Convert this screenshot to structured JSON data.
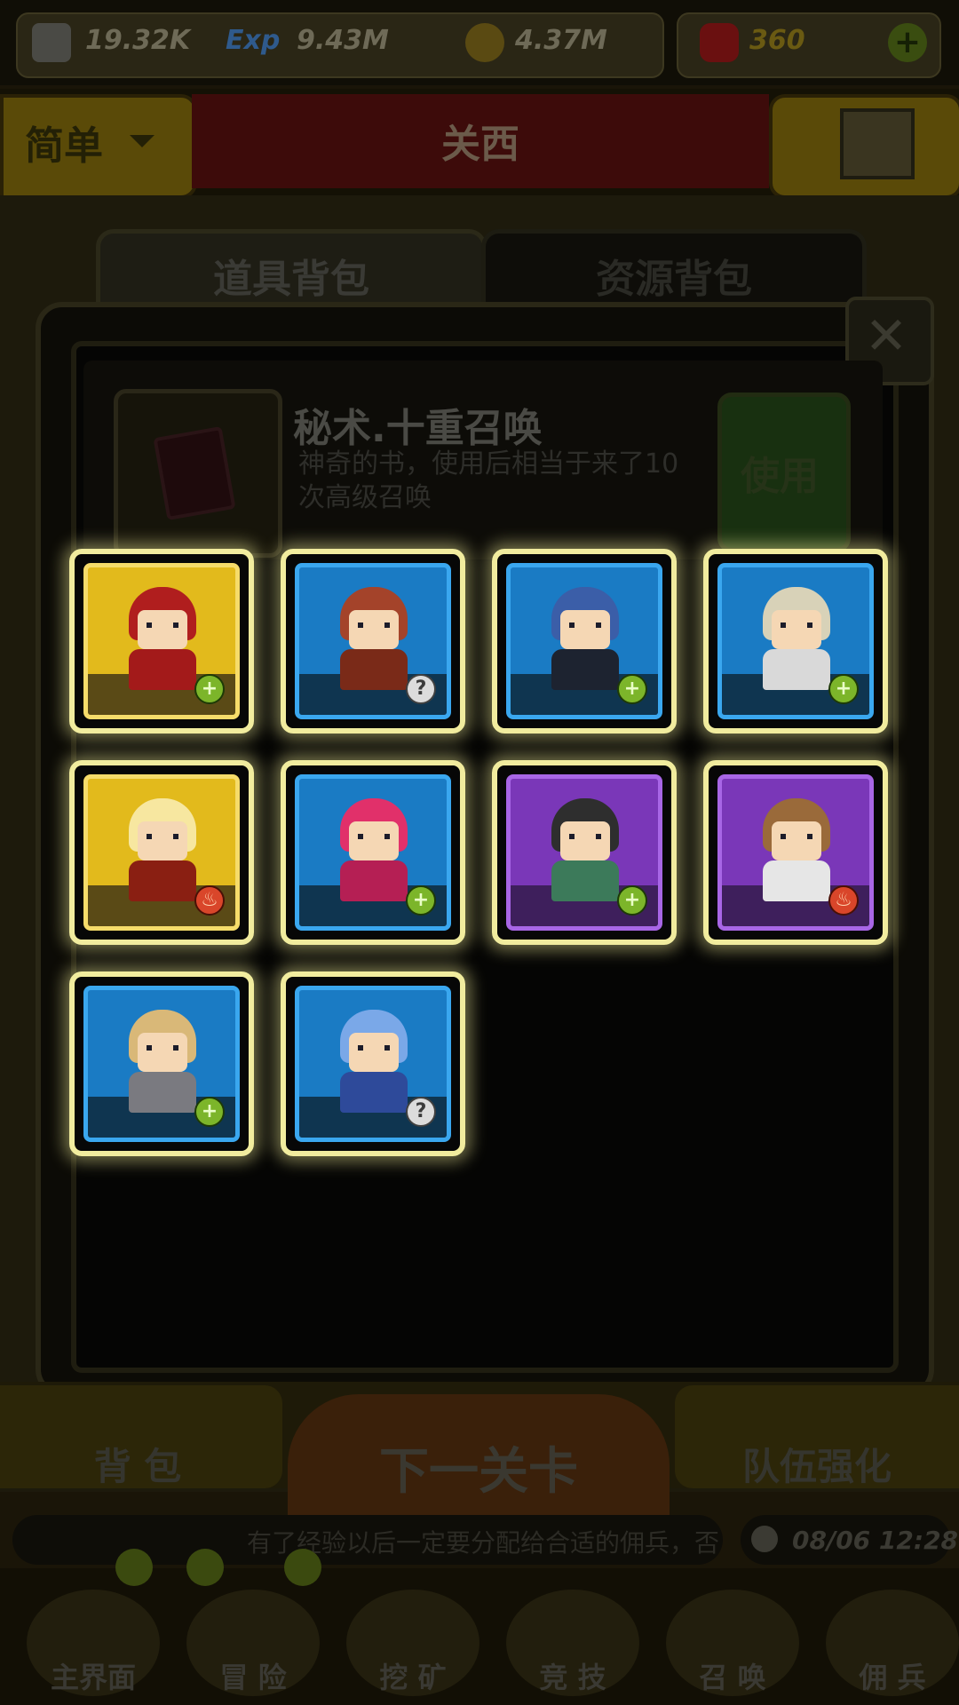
{
  "resources": {
    "attack": "19.32K",
    "exp": "9.43M",
    "gold": "4.37M",
    "gems": "360"
  },
  "stage": {
    "difficulty": "简单",
    "name": "关西"
  },
  "tabs": {
    "items": "道具背包",
    "resources": "资源背包"
  },
  "item": {
    "name": "秘术.十重召唤",
    "desc_line1": "神奇的书，使用后相当于来了10",
    "desc_line2": "次高级召唤",
    "use_label": "使用"
  },
  "heroes": [
    {
      "rarity": "gold",
      "badge": "plus",
      "badge_glyph": "+",
      "hair": "#b01e1e",
      "body": "#a31a1a"
    },
    {
      "rarity": "blue",
      "badge": "help",
      "badge_glyph": "?",
      "hair": "#a4432a",
      "body": "#7a2a18"
    },
    {
      "rarity": "blue",
      "badge": "plus",
      "badge_glyph": "+",
      "hair": "#3b5ea8",
      "body": "#1d2330"
    },
    {
      "rarity": "blue",
      "badge": "plus",
      "badge_glyph": "+",
      "hair": "#d8d2b8",
      "body": "#d9d9d9"
    },
    {
      "rarity": "gold",
      "badge": "fire",
      "badge_glyph": "♨",
      "hair": "#f7e7a0",
      "body": "#8a1f12"
    },
    {
      "rarity": "blue",
      "badge": "plus",
      "badge_glyph": "+",
      "hair": "#e1306a",
      "body": "#b51f54"
    },
    {
      "rarity": "purple",
      "badge": "plus",
      "badge_glyph": "+",
      "hair": "#2e2e2e",
      "body": "#3c7a5a"
    },
    {
      "rarity": "purple",
      "badge": "fire",
      "badge_glyph": "♨",
      "hair": "#9a6a3a",
      "body": "#e6e6e6"
    },
    {
      "rarity": "blue",
      "badge": "plus",
      "badge_glyph": "+",
      "hair": "#d9b878",
      "body": "#7a7a80"
    },
    {
      "rarity": "blue",
      "badge": "help",
      "badge_glyph": "?",
      "hair": "#7aa8e8",
      "body": "#2e4a9a"
    }
  ],
  "bottom": {
    "backpack": "背 包",
    "next_stage": "下一关卡",
    "team_upgrade": "队伍强化",
    "ticker": "有了经验以后一定要分配给合适的佣兵，否",
    "clock": "08/06 12:28"
  },
  "nav": [
    "主界面",
    "冒 险",
    "挖 矿",
    "竞 技",
    "召 唤",
    "佣 兵"
  ]
}
